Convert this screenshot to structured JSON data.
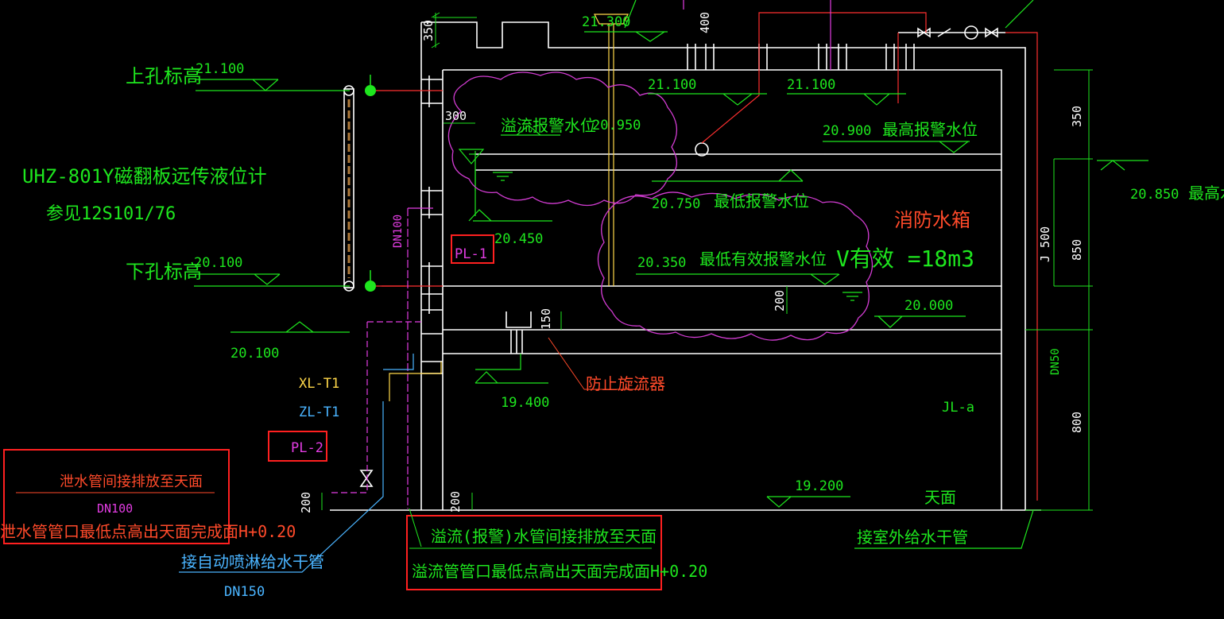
{
  "labels": {
    "upper_hole": "上孔标高",
    "lower_hole": "下孔标高",
    "gauge_model": "UHZ-801Y磁翻板远传液位计",
    "gauge_ref": "参见12S101/76",
    "overflow_alarm": "溢流报警水位",
    "max_alarm": "最高报警水位",
    "min_alarm": "最低报警水位",
    "min_effective": "最低有效报警水位",
    "tank_name": "消防水箱",
    "volume": "V有效 =18m3",
    "anti_vortex": "防止旋流器",
    "roof": "天面",
    "outdoor_supply": "接室外给水干管",
    "sprinkler_supply": "接自动喷淋给水干管",
    "drain_note_1": "泄水管间接排放至天面",
    "drain_note_2": "泄水管管口最低点高出天面完成面H+0.20",
    "overflow_note_1": "溢流(报警)水管间接排放至天面",
    "overflow_note_2": "溢流管管口最低点高出天面完成面H+0.20",
    "max_level_right": "最高水"
  },
  "elevations": {
    "e21300": "21.300",
    "e21100_a": "21.100",
    "e21100_b": "21.100",
    "e21100_c": "21.100",
    "e20950": "20.950",
    "e20900": "20.900",
    "e20850": "20.850",
    "e20750": "20.750",
    "e20450": "20.450",
    "e20350": "20.350",
    "e20100_a": "20.100",
    "e20100_b": "20.100",
    "e20000": "20.000",
    "e19400": "19.400",
    "e19200": "19.200"
  },
  "pipes": {
    "pl1": "PL-1",
    "pl2": "PL-2",
    "xl": "XL-T1",
    "zl": "ZL-T1",
    "jl": "JL-a",
    "dn100": "DN100",
    "dn100_v": "DN100",
    "dn150": "DN150",
    "dn50": "DN50"
  },
  "dimensions": {
    "d350_top": "350",
    "d400": "400",
    "d300": "300",
    "d350_right": "350",
    "d500": "J 500",
    "d850": "850",
    "d800": "800",
    "d200_mid": "200",
    "d150": "150",
    "d200_left": "200",
    "d200_bottom": "200"
  },
  "colors": {
    "background": "#000000",
    "structure": "#ffffff",
    "text": "#1ee61e",
    "highlight_box": "#ff2020",
    "cloud": "#d23cd2",
    "pipe_red": "#ff3030",
    "pipe_magenta": "#e23ce2",
    "pipe_yellow": "#ffd84a",
    "pipe_cyan": "#4ab4ff"
  }
}
